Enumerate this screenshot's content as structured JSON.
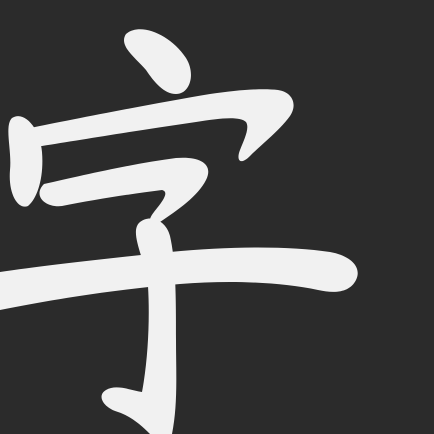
{
  "icon": {
    "glyph": "字",
    "background_color": "#2b2b2b",
    "glyph_color": "#f1f1f1"
  }
}
